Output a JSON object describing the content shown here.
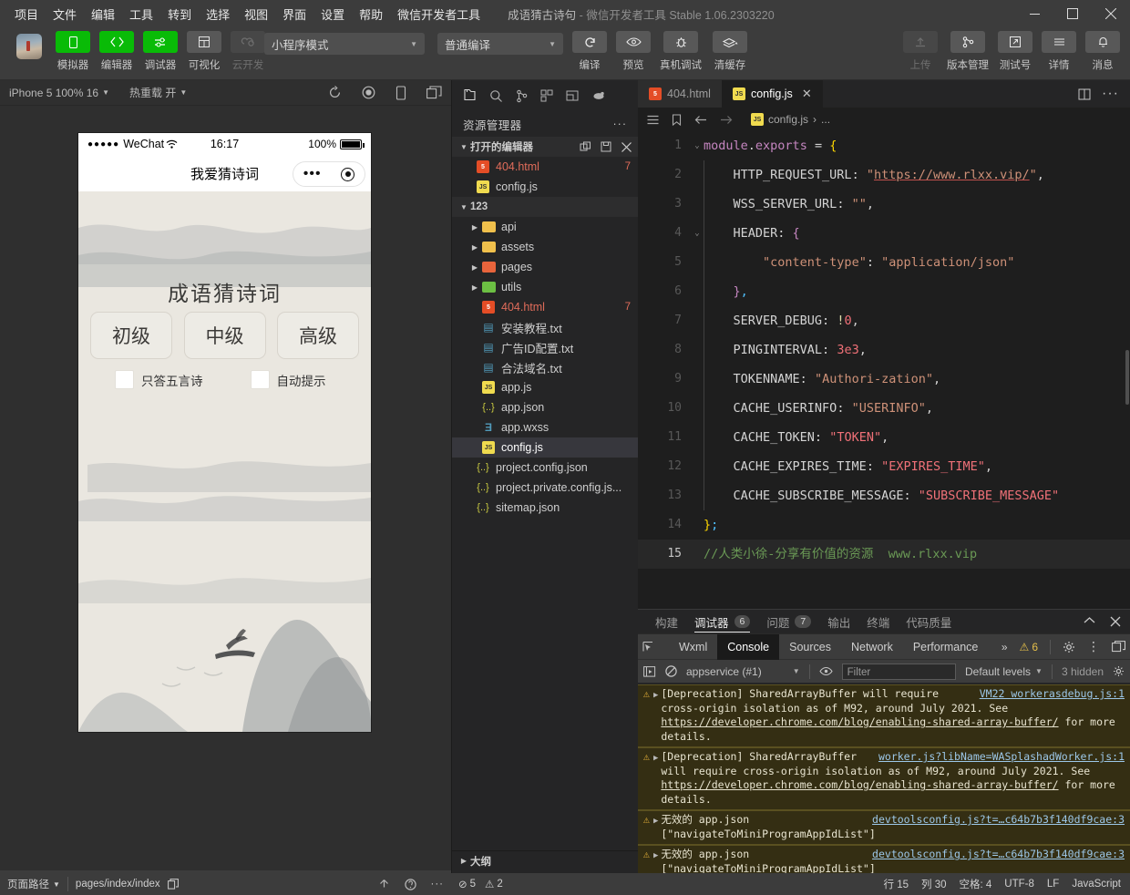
{
  "titlebar": {
    "menus": [
      "项目",
      "文件",
      "编辑",
      "工具",
      "转到",
      "选择",
      "视图",
      "界面",
      "设置",
      "帮助",
      "微信开发者工具"
    ],
    "project_name": "成语猜古诗句",
    "separator": "-",
    "app_name": "微信开发者工具",
    "version": "Stable 1.06.2303220",
    "minimize": "—",
    "maximize": "□",
    "close": "✕"
  },
  "toolbar": {
    "items": [
      {
        "label": "模拟器",
        "icon": "phone-icon",
        "state": "green"
      },
      {
        "label": "编辑器",
        "icon": "code-icon",
        "state": "green"
      },
      {
        "label": "调试器",
        "icon": "sliders-icon",
        "state": "green"
      },
      {
        "label": "可视化",
        "icon": "layout-icon",
        "state": "grey"
      },
      {
        "label": "云开发",
        "icon": "cloud-icon",
        "state": "disabled"
      }
    ],
    "mode_select": "小程序模式",
    "compile_select": "普通编译",
    "actions": [
      {
        "label": "编译",
        "icon": "refresh-icon"
      },
      {
        "label": "预览",
        "icon": "eye-icon"
      },
      {
        "label": "真机调试",
        "icon": "bug-icon"
      },
      {
        "label": "清缓存",
        "icon": "layers-icon"
      }
    ],
    "right_actions": [
      {
        "label": "上传",
        "icon": "upload-icon",
        "state": "disabled"
      },
      {
        "label": "版本管理",
        "icon": "branch-icon"
      },
      {
        "label": "测试号",
        "icon": "external-icon"
      },
      {
        "label": "详情",
        "icon": "menu-icon"
      },
      {
        "label": "消息",
        "icon": "bell-icon"
      }
    ]
  },
  "simulator": {
    "device_label": "iPhone 5 100% 16",
    "hotreload_label": "热重载 开",
    "toolbar_icons": [
      "rotate-icon",
      "record-icon",
      "device-icon",
      "window-icon"
    ],
    "phone": {
      "signal_dots": "●●●●●",
      "carrier": "WeChat",
      "wifi_icon": "wifi-icon",
      "time": "16:17",
      "battery_pct": "100%",
      "nav_title": "我爱猜诗词",
      "capsule_dots": "•••",
      "capsule_target": "target-icon",
      "game_title": "成语猜诗词",
      "levels": [
        "初级",
        "中级",
        "高级"
      ],
      "options": [
        {
          "label": "只答五言诗",
          "checked": false
        },
        {
          "label": "自动提示",
          "checked": false
        }
      ]
    },
    "footer": {
      "page_path_label": "页面路径",
      "page_path_value": "pages/index/index",
      "copy_icon": "copy-icon"
    }
  },
  "explorer": {
    "sidebar_icons": [
      "files-icon",
      "search-icon",
      "source-control-icon",
      "extensions-icon",
      "debug-icon",
      "cloud-icon"
    ],
    "title": "资源管理器",
    "more": "···",
    "open_editors": {
      "label": "打开的编辑器",
      "actions": [
        "new-file-icon",
        "save-all-icon",
        "close-all-icon"
      ],
      "items": [
        {
          "name": "404.html",
          "icon": "html-icon",
          "badge": "7",
          "color": "#e06c5a"
        },
        {
          "name": "config.js",
          "icon": "js-icon",
          "badge": "",
          "color": "#cfcfcf"
        }
      ]
    },
    "project": {
      "label": "123",
      "items": [
        {
          "name": "api",
          "type": "folder",
          "color": "#f0c04c",
          "indent": 2,
          "badge": ""
        },
        {
          "name": "assets",
          "type": "folder",
          "color": "#f0c04c",
          "indent": 2,
          "badge": ""
        },
        {
          "name": "pages",
          "type": "folder",
          "color": "#e8643c",
          "indent": 2,
          "badge": ""
        },
        {
          "name": "utils",
          "type": "folder",
          "color": "#6cbf43",
          "indent": 2,
          "badge": ""
        },
        {
          "name": "404.html",
          "type": "html",
          "color": "#e06c5a",
          "indent": 3,
          "badge": "7"
        },
        {
          "name": "安装教程.txt",
          "type": "txt",
          "color": "#cfcfcf",
          "indent": 3,
          "badge": ""
        },
        {
          "name": "广告ID配置.txt",
          "type": "txt",
          "color": "#cfcfcf",
          "indent": 3,
          "badge": ""
        },
        {
          "name": "合法域名.txt",
          "type": "txt",
          "color": "#cfcfcf",
          "indent": 3,
          "badge": ""
        },
        {
          "name": "app.js",
          "type": "js",
          "color": "#cfcfcf",
          "indent": 3,
          "badge": ""
        },
        {
          "name": "app.json",
          "type": "json",
          "color": "#cfcfcf",
          "indent": 3,
          "badge": ""
        },
        {
          "name": "app.wxss",
          "type": "wxss",
          "color": "#cfcfcf",
          "indent": 3,
          "badge": ""
        },
        {
          "name": "config.js",
          "type": "js",
          "color": "#ffffff",
          "indent": 3,
          "badge": "",
          "active": true
        },
        {
          "name": "project.config.json",
          "type": "json",
          "color": "#cfcfcf",
          "indent": 3,
          "badge": ""
        },
        {
          "name": "project.private.config.js...",
          "type": "json",
          "color": "#cfcfcf",
          "indent": 3,
          "badge": ""
        },
        {
          "name": "sitemap.json",
          "type": "json",
          "color": "#cfcfcf",
          "indent": 3,
          "badge": ""
        }
      ]
    },
    "outline_label": "大纲"
  },
  "editor": {
    "tabs": [
      {
        "label": "404.html",
        "icon": "html-icon",
        "active": false,
        "closable": false
      },
      {
        "label": "config.js",
        "icon": "js-icon",
        "active": true,
        "closable": true
      }
    ],
    "tab_actions": [
      "split-editor-icon",
      "more-icon"
    ],
    "breadcrumb_icons": [
      "outline-icon",
      "bookmark-icon",
      "back-icon",
      "forward-icon"
    ],
    "breadcrumb": {
      "file": "config.js",
      "sep": "›",
      "rest": "..."
    },
    "lines": [
      {
        "n": "1",
        "fold": "⌄",
        "indent": false,
        "tokens": [
          {
            "t": "module",
            "c": "k-purple"
          },
          {
            "t": ".",
            "c": "k-white"
          },
          {
            "t": "exports",
            "c": "k-purple"
          },
          {
            "t": " = ",
            "c": "k-white"
          },
          {
            "t": "{",
            "c": "k-brace"
          }
        ]
      },
      {
        "n": "2",
        "fold": "",
        "indent": true,
        "tokens": [
          {
            "t": "    HTTP_REQUEST_URL",
            "c": "k-white"
          },
          {
            "t": ": ",
            "c": "k-white"
          },
          {
            "t": "\"",
            "c": "k-orange"
          },
          {
            "t": "https://www.rlxx.vip/",
            "c": "k-link"
          },
          {
            "t": "\"",
            "c": "k-orange"
          },
          {
            "t": ",",
            "c": "k-white"
          }
        ]
      },
      {
        "n": "3",
        "fold": "",
        "indent": true,
        "tokens": [
          {
            "t": "    WSS_SERVER_URL",
            "c": "k-white"
          },
          {
            "t": ": ",
            "c": "k-white"
          },
          {
            "t": "\"\"",
            "c": "k-orange"
          },
          {
            "t": ",",
            "c": "k-white"
          }
        ]
      },
      {
        "n": "4",
        "fold": "⌄",
        "indent": true,
        "tokens": [
          {
            "t": "    HEADER",
            "c": "k-white"
          },
          {
            "t": ": ",
            "c": "k-white"
          },
          {
            "t": "{",
            "c": "k-purple"
          }
        ]
      },
      {
        "n": "5",
        "fold": "",
        "indent": true,
        "tokens": [
          {
            "t": "        ",
            "c": "k-white"
          },
          {
            "t": "\"content-type\"",
            "c": "k-orange"
          },
          {
            "t": ": ",
            "c": "k-white"
          },
          {
            "t": "\"application/json\"",
            "c": "k-orange"
          }
        ]
      },
      {
        "n": "6",
        "fold": "",
        "indent": true,
        "tokens": [
          {
            "t": "    }",
            "c": "k-purple"
          },
          {
            "t": ",",
            "c": "k-lblue"
          }
        ]
      },
      {
        "n": "7",
        "fold": "",
        "indent": true,
        "tokens": [
          {
            "t": "    SERVER_DEBUG",
            "c": "k-white"
          },
          {
            "t": ": ",
            "c": "k-white"
          },
          {
            "t": "!",
            "c": "k-yellow"
          },
          {
            "t": "0",
            "c": "k-red"
          },
          {
            "t": ",",
            "c": "k-white"
          }
        ]
      },
      {
        "n": "8",
        "fold": "",
        "indent": true,
        "tokens": [
          {
            "t": "    PINGINTERVAL",
            "c": "k-white"
          },
          {
            "t": ": ",
            "c": "k-white"
          },
          {
            "t": "3e3",
            "c": "k-red"
          },
          {
            "t": ",",
            "c": "k-white"
          }
        ]
      },
      {
        "n": "9",
        "fold": "",
        "indent": true,
        "tokens": [
          {
            "t": "    TOKENNAME",
            "c": "k-white"
          },
          {
            "t": ": ",
            "c": "k-white"
          },
          {
            "t": "\"Authori-zation\"",
            "c": "k-orange"
          },
          {
            "t": ",",
            "c": "k-white"
          }
        ]
      },
      {
        "n": "10",
        "fold": "",
        "indent": true,
        "tokens": [
          {
            "t": "    CACHE_USERINFO",
            "c": "k-white"
          },
          {
            "t": ": ",
            "c": "k-white"
          },
          {
            "t": "\"USERINFO\"",
            "c": "k-orange"
          },
          {
            "t": ",",
            "c": "k-white"
          }
        ]
      },
      {
        "n": "11",
        "fold": "",
        "indent": true,
        "tokens": [
          {
            "t": "    CACHE_TOKEN",
            "c": "k-white"
          },
          {
            "t": ": ",
            "c": "k-white"
          },
          {
            "t": "\"TOKEN\"",
            "c": "k-red"
          },
          {
            "t": ",",
            "c": "k-white"
          }
        ]
      },
      {
        "n": "12",
        "fold": "",
        "indent": true,
        "tokens": [
          {
            "t": "    CACHE_EXPIRES_TIME",
            "c": "k-white"
          },
          {
            "t": ": ",
            "c": "k-white"
          },
          {
            "t": "\"EXPIRES_TIME\"",
            "c": "k-red"
          },
          {
            "t": ",",
            "c": "k-white"
          }
        ]
      },
      {
        "n": "13",
        "fold": "",
        "indent": true,
        "tokens": [
          {
            "t": "    CACHE_SUBSCRIBE_MESSAGE",
            "c": "k-white"
          },
          {
            "t": ": ",
            "c": "k-white"
          },
          {
            "t": "\"SUBSCRIBE_MESSAGE\"",
            "c": "k-red"
          }
        ]
      },
      {
        "n": "14",
        "fold": "",
        "indent": false,
        "tokens": [
          {
            "t": "}",
            "c": "k-brace"
          },
          {
            "t": ";",
            "c": "k-lblue"
          }
        ]
      },
      {
        "n": "15",
        "fold": "",
        "indent": false,
        "current": true,
        "highlight": true,
        "tokens": [
          {
            "t": "//人类小徐-分享有价值的资源  www.rlxx.vip",
            "c": "k-green"
          }
        ]
      }
    ]
  },
  "debug": {
    "tabs": [
      {
        "label": "构建",
        "badge": "",
        "active": false
      },
      {
        "label": "调试器",
        "badge": "6",
        "active": true
      },
      {
        "label": "问题",
        "badge": "7",
        "active": false
      },
      {
        "label": "输出",
        "badge": "",
        "active": false
      },
      {
        "label": "终端",
        "badge": "",
        "active": false
      },
      {
        "label": "代码质量",
        "badge": "",
        "active": false
      }
    ],
    "panel_actions": [
      "collapse-icon",
      "close-icon"
    ],
    "devtools_tabs": [
      "Wxml",
      "Console",
      "Sources",
      "Network",
      "Performance"
    ],
    "devtools_active": "Console",
    "overflow": "»",
    "warn_count": "6",
    "devtools_right_icons": [
      "gear-icon",
      "kebab-icon",
      "dock-icon"
    ],
    "filter_bar": {
      "execute_icon": "execute-icon",
      "clear_icon": "clear-icon",
      "context": "appservice (#1)",
      "eye_icon": "eye-icon",
      "filter_placeholder": "Filter",
      "levels": "Default levels",
      "hidden": "3 hidden",
      "settings_icon": "gear-icon"
    },
    "messages": [
      {
        "prefix": "[Deprecation]",
        "text": "SharedArrayBuffer will require cross-origin isolation as of M92, around July 2021. See ",
        "link": "https://developer.chrome.com/blog/enabling-shared-array-buffer/",
        "suffix": " for more details.",
        "source": "VM22 workerasdebug.js:1"
      },
      {
        "prefix": "[Deprecation]",
        "text": "SharedArrayBuffer will require cross-origin isolation as of M92, around July 2021. See ",
        "link": "https://developer.chrome.com/blog/enabling-shared-array-buffer/",
        "suffix": " for more details.",
        "source": "worker.js?libName=WASplashadWorker.js:1"
      },
      {
        "prefix": "无效的",
        "text": "app.json [\"navigateToMiniProgramAppIdList\"]",
        "link": "",
        "suffix": "",
        "source": "devtoolsconfig.js?t=…c64b7b3f140df9cae:3"
      },
      {
        "prefix": "无效的",
        "text": "app.json [\"navigateToMiniProgramAppIdList\"]",
        "link": "",
        "suffix": "",
        "source": "devtoolsconfig.js?t=…c64b7b3f140df9cae:3"
      }
    ],
    "prompt": "›"
  },
  "statusbar": {
    "left_label": "页面路径",
    "left_value": "pages/index/index",
    "copy_icon": "copy-icon",
    "mid_ok": "5",
    "mid_warn": "2",
    "right": [
      "行 15",
      "列 30",
      "空格: 4",
      "UTF-8",
      "LF",
      "JavaScript"
    ]
  },
  "colors": {
    "accent_green": "#09bb07",
    "warn_yellow": "#e8b339",
    "editor_bg": "#1e1e1e",
    "panel_bg": "#252526",
    "chrome_bg": "#3c3c3c"
  }
}
